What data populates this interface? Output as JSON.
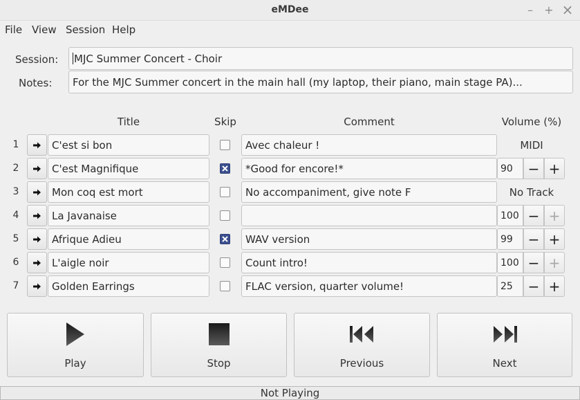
{
  "window": {
    "title": "eMDee",
    "minimize_glyph": "–",
    "maximize_glyph": "+",
    "close_glyph": "×"
  },
  "menu": [
    "File",
    "View",
    "Session",
    "Help"
  ],
  "session": {
    "session_label": "Session:",
    "session_value": "MJC Summer Concert - Choir",
    "notes_label": "Notes:",
    "notes_value": "For the MJC Summer concert in the main hall (my laptop, their piano, main stage PA)..."
  },
  "table": {
    "headers": {
      "title": "Title",
      "skip": "Skip",
      "comment": "Comment",
      "volume": "Volume (%)"
    },
    "rows": [
      {
        "num": "1",
        "title": "C'est si bon",
        "skip": false,
        "comment": "Avec chaleur !",
        "volume_text": "MIDI"
      },
      {
        "num": "2",
        "title": "C'est Magnifique",
        "skip": true,
        "comment": "*Good for encore!*",
        "volume": "90",
        "plus_enabled": true
      },
      {
        "num": "3",
        "title": "Mon coq est mort",
        "skip": false,
        "comment": "No accompaniment, give note F",
        "volume_text": "No Track"
      },
      {
        "num": "4",
        "title": "La Javanaise",
        "skip": false,
        "comment": "",
        "volume": "100",
        "plus_enabled": false
      },
      {
        "num": "5",
        "title": "Afrique Adieu",
        "skip": true,
        "comment": "WAV version",
        "volume": "99",
        "plus_enabled": true
      },
      {
        "num": "6",
        "title": "L'aigle noir",
        "skip": false,
        "comment": "Count intro!",
        "volume": "100",
        "plus_enabled": false
      },
      {
        "num": "7",
        "title": "Golden Earrings",
        "skip": false,
        "comment": "FLAC version, quarter volume!",
        "volume": "25",
        "plus_enabled": true
      }
    ],
    "minus_glyph": "−",
    "plus_glyph": "+"
  },
  "controls": {
    "play": "Play",
    "stop": "Stop",
    "previous": "Previous",
    "next": "Next"
  },
  "status": "Not Playing"
}
